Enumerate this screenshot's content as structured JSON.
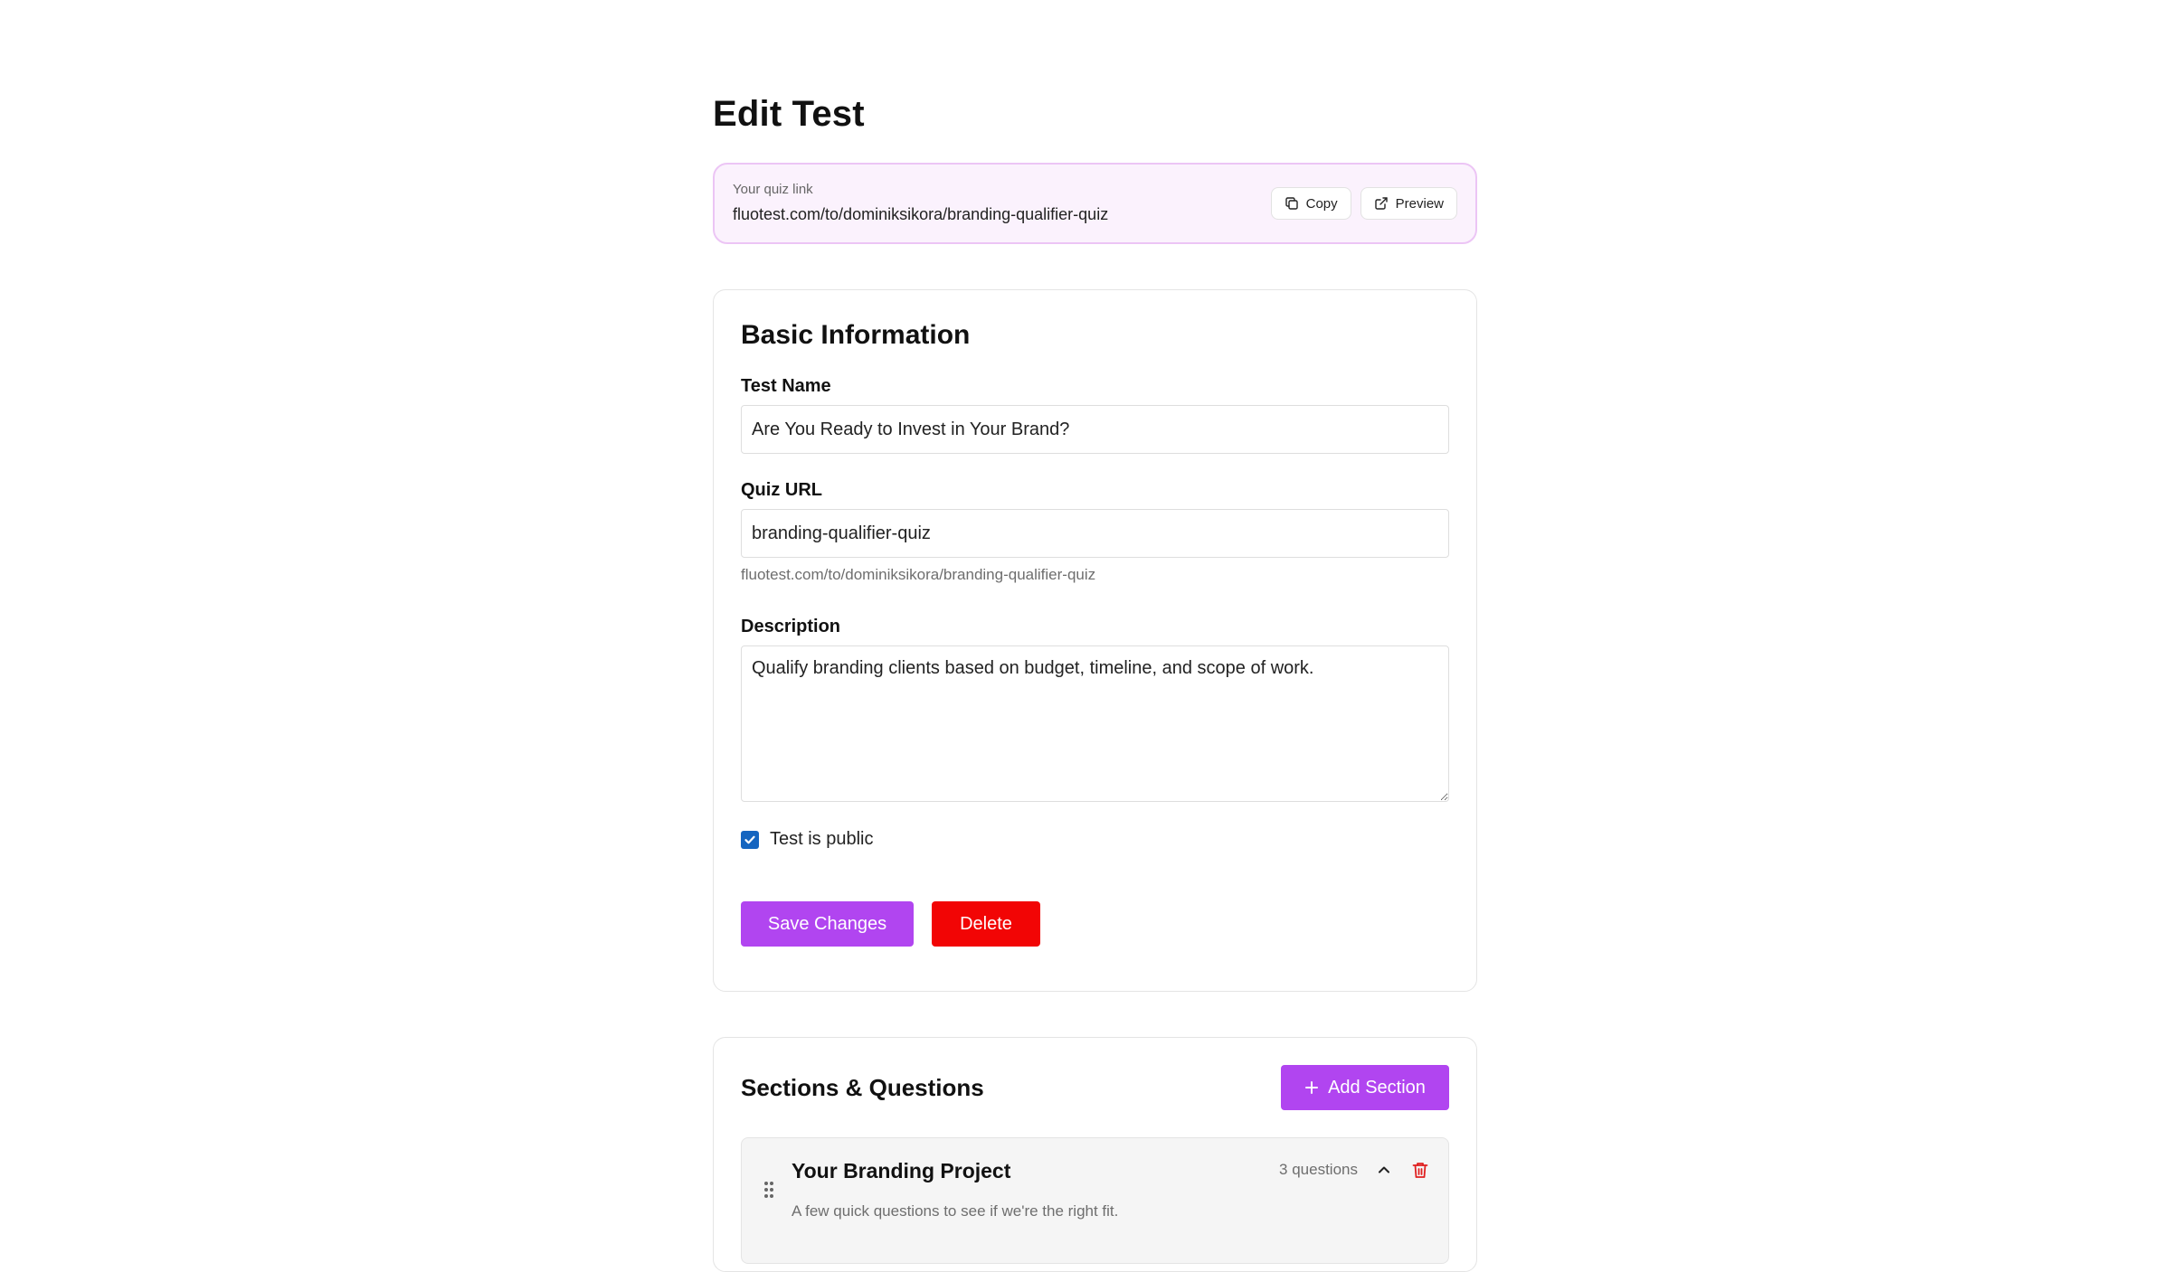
{
  "page": {
    "title": "Edit Test"
  },
  "quiz_link": {
    "caption": "Your quiz link",
    "url": "fluotest.com/to/dominiksikora/branding-qualifier-quiz",
    "copy_label": "Copy",
    "preview_label": "Preview"
  },
  "basic_info": {
    "title": "Basic Information",
    "test_name_label": "Test Name",
    "test_name_value": "Are You Ready to Invest in Your Brand?",
    "quiz_url_label": "Quiz URL",
    "quiz_url_value": "branding-qualifier-quiz",
    "quiz_url_helper": "fluotest.com/to/dominiksikora/branding-qualifier-quiz",
    "description_label": "Description",
    "description_value": "Qualify branding clients based on budget, timeline, and scope of work.",
    "public_label": "Test is public",
    "public_checked": true,
    "save_label": "Save Changes",
    "delete_label": "Delete"
  },
  "sections": {
    "title": "Sections & Questions",
    "add_label": "Add Section",
    "items": [
      {
        "name": "Your Branding Project",
        "description": "A few quick questions to see if we're the right fit.",
        "question_count": "3 questions"
      }
    ]
  },
  "colors": {
    "accent": "#b145f0",
    "danger": "#f20505",
    "banner_bg": "#fbf2fd",
    "banner_border": "#ecc5f5",
    "checkbox": "#1565c0"
  }
}
